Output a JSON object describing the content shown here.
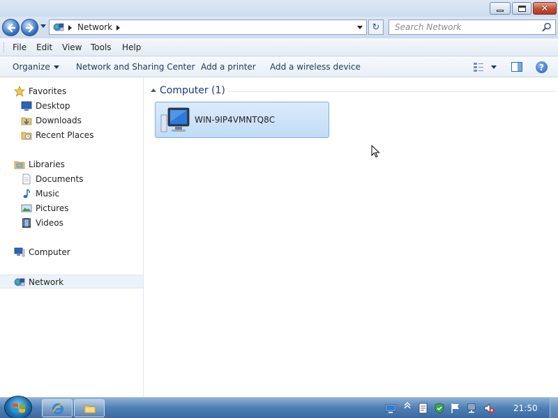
{
  "window": {
    "minimize_glyph": "—",
    "restore_glyph": "",
    "close_glyph": "✕"
  },
  "address": {
    "location": "Network",
    "refresh_glyph": "↻",
    "search_placeholder": "Search Network"
  },
  "menu": {
    "items": [
      "File",
      "Edit",
      "View",
      "Tools",
      "Help"
    ]
  },
  "commands": {
    "organize": "Organize",
    "network_sharing": "Network and Sharing Center",
    "add_printer": "Add a printer",
    "add_wireless": "Add a wireless device",
    "help_glyph": "?"
  },
  "nav": {
    "favorites": "Favorites",
    "desktop": "Desktop",
    "downloads": "Downloads",
    "recent_places": "Recent Places",
    "libraries": "Libraries",
    "documents": "Documents",
    "music": "Music",
    "pictures": "Pictures",
    "videos": "Videos",
    "computer": "Computer",
    "network": "Network"
  },
  "content": {
    "group_title": "Computer (1)",
    "items": [
      {
        "label": "WIN-9IP4VMNTQ8C",
        "icon": "computer-icon"
      }
    ]
  },
  "taskbar": {
    "clock": "21:50"
  },
  "colors": {
    "accent": "#1e3287",
    "selection": "#c1dcf8",
    "taskbar": "#4e7fb4"
  }
}
